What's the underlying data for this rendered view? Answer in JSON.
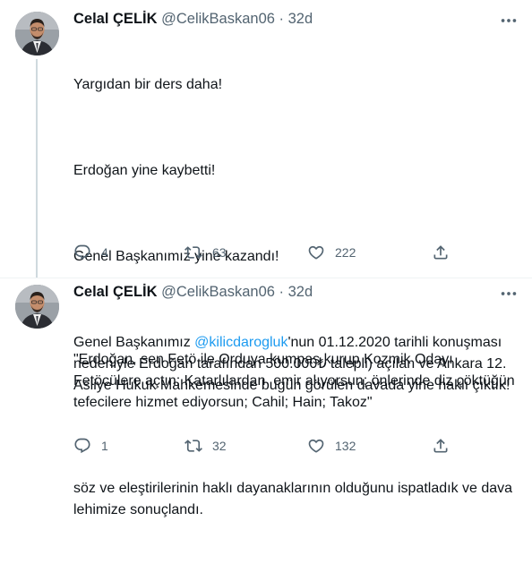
{
  "tweets": [
    {
      "name": "Celal ÇELİK",
      "handle": "@CelikBaskan06",
      "separator": "·",
      "time": "32d",
      "paragraphs": [
        "Yargıdan bir ders daha!",
        "Erdoğan yine kaybetti!",
        "Genel Başkanımız yine kazandı!"
      ],
      "last_paragraph": {
        "before_mention": "Genel Başkanımız ",
        "mention": "@kilicdarogluk",
        "after_mention": "'nun 01.12.2020 tarihli konuşması nedeniyle Erdoğan tarafından 500.000₺ talepli) açılan ve Ankara 12. Asliye Hukuk Mahkemesinde bugün görülen davada yine haklı çıktık!"
      },
      "replies": "4",
      "retweets": "63",
      "likes": "222"
    },
    {
      "name": "Celal ÇELİK",
      "handle": "@CelikBaskan06",
      "separator": "·",
      "time": "32d",
      "paragraphs": [
        "\"Erdoğan, sen Fetö ile Orduya kumpas kurup Kozmik Odayı Fetöcülere açtın; Katarlılardan  emir alıyorsun; önlerinde diz çöktüğün tefecilere hizmet ediyorsun; Cahil; Hain; Takoz\"",
        "söz ve eleştirilerinin haklı dayanaklarının olduğunu ispatladık ve dava lehimize sonuçlandı."
      ],
      "replies": "1",
      "retweets": "32",
      "likes": "132"
    }
  ],
  "icons": {
    "avatar": "profile-photo",
    "more": "more-horizontal-icon",
    "reply": "reply-icon",
    "retweet": "retweet-icon",
    "like": "heart-icon",
    "share": "share-icon"
  },
  "colors": {
    "link": "#1d9bf0",
    "secondary_text": "#536471",
    "thread_line": "#cfd9de"
  }
}
